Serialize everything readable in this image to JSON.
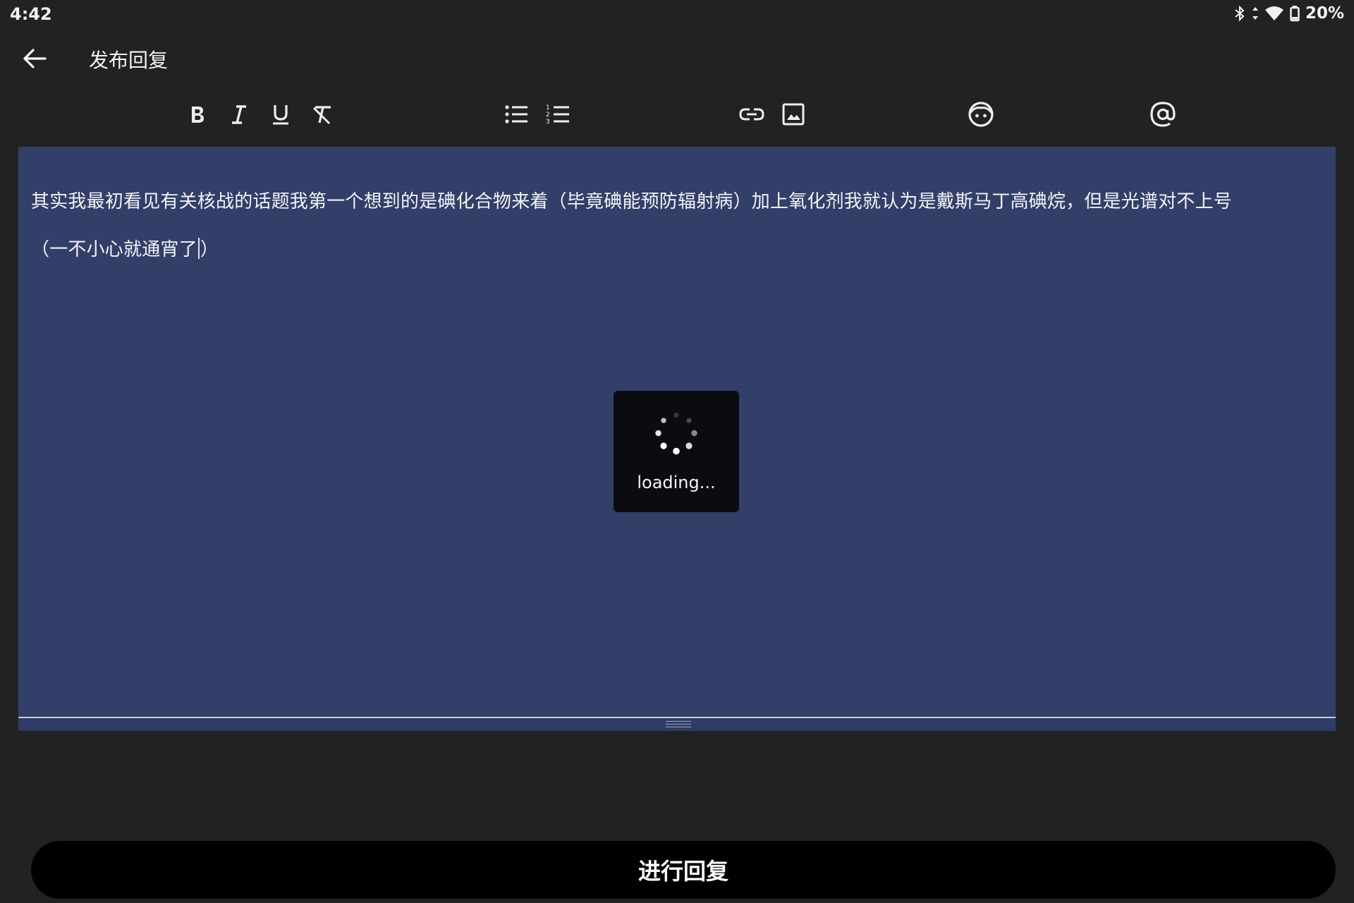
{
  "status_bar": {
    "time": "4:42",
    "battery_percent": "20%",
    "icons": [
      "bluetooth-icon",
      "data-arrows-icon",
      "wifi-icon",
      "battery-icon"
    ]
  },
  "app_bar": {
    "title": "发布回复",
    "back_icon": "arrow-left-icon"
  },
  "toolbar": {
    "tools": [
      "bold",
      "italic",
      "underline",
      "clear-format",
      "bullet-list",
      "numbered-list",
      "link",
      "image",
      "emoji",
      "mention"
    ]
  },
  "editor": {
    "line_1": "其实我最初看见有关核战的话题我第一个想到的是碘化合物来着（毕竟碘能预防辐射病）加上氧化剂我就认为是戴斯马丁高碘烷，但是光谱对不上号",
    "line_2_before_caret": "（一不小心就通宵了",
    "line_2_after_caret": "）",
    "background_color": "#323f69"
  },
  "loading": {
    "text": "loading..."
  },
  "footer": {
    "reply_button_label": "进行回复"
  }
}
